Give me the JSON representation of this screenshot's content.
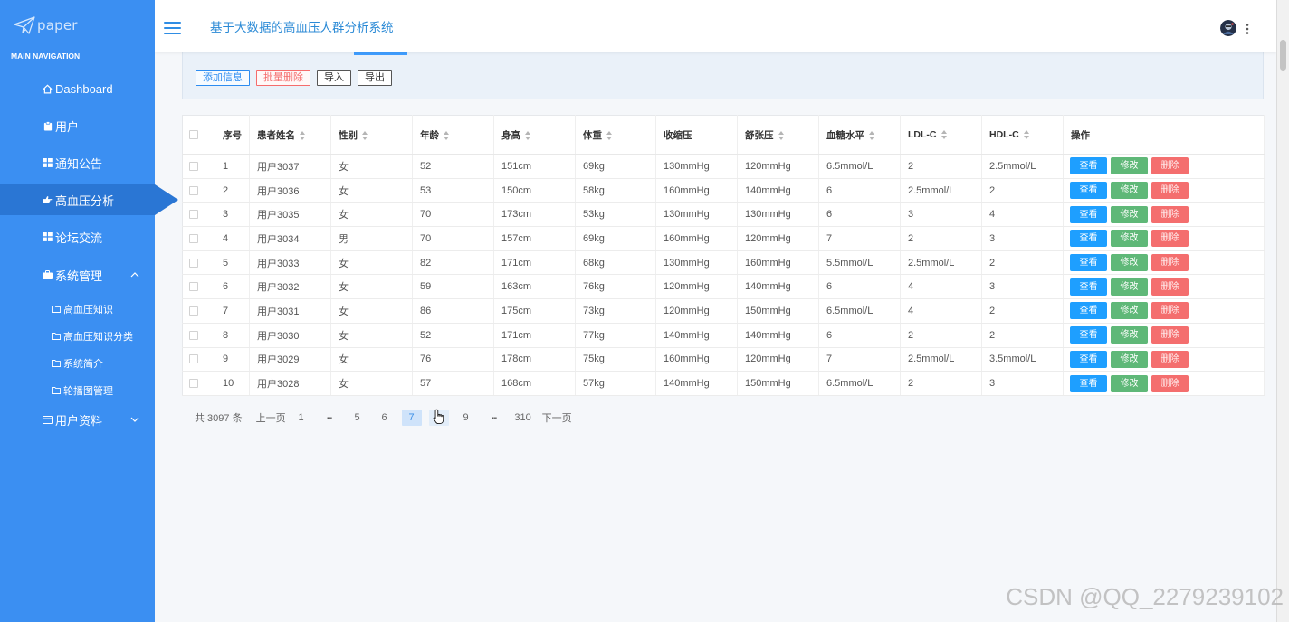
{
  "app": {
    "logo_text": "paper",
    "title": "基于大数据的高血压人群分析系统"
  },
  "sidebar": {
    "heading": "MAIN NAVIGATION",
    "items": [
      {
        "label": "Dashboard",
        "icon": "home-icon"
      },
      {
        "label": "用户",
        "icon": "clipboard-icon"
      },
      {
        "label": "通知公告",
        "icon": "grid-icon"
      },
      {
        "label": "高血压分析",
        "icon": "hand-icon",
        "active": true
      },
      {
        "label": "论坛交流",
        "icon": "grid-icon"
      },
      {
        "label": "系统管理",
        "icon": "briefcase-icon",
        "expanded": true,
        "children": [
          {
            "label": "高血压知识",
            "icon": "folder-icon"
          },
          {
            "label": "高血压知识分类",
            "icon": "folder-icon"
          },
          {
            "label": "系统简介",
            "icon": "folder-icon"
          },
          {
            "label": "轮播图管理",
            "icon": "folder-icon"
          }
        ]
      },
      {
        "label": "用户资料",
        "icon": "id-card-icon",
        "expanded": false
      }
    ]
  },
  "header": {
    "menu_icon": "hamburger-icon",
    "avatar_icon": "avatar",
    "more_icon": "more-vertical-icon"
  },
  "toolbar": {
    "add_label": "添加信息",
    "batch_delete_label": "批量删除",
    "import_label": "导入",
    "export_label": "导出"
  },
  "table": {
    "columns": [
      {
        "label": "序号",
        "sortable": false
      },
      {
        "label": "患者姓名",
        "sortable": true
      },
      {
        "label": "性别",
        "sortable": true
      },
      {
        "label": "年龄",
        "sortable": true
      },
      {
        "label": "身高",
        "sortable": true
      },
      {
        "label": "体重",
        "sortable": true
      },
      {
        "label": "收缩压",
        "sortable": false
      },
      {
        "label": "舒张压",
        "sortable": true
      },
      {
        "label": "血糖水平",
        "sortable": true
      },
      {
        "label": "LDL-C",
        "sortable": true
      },
      {
        "label": "HDL-C",
        "sortable": true
      },
      {
        "label": "操作",
        "sortable": false
      }
    ],
    "rows": [
      [
        "1",
        "用户3037",
        "女",
        "52",
        "151cm",
        "69kg",
        "130mmHg",
        "120mmHg",
        "6.5mmol/L",
        "2",
        "2.5mmol/L"
      ],
      [
        "2",
        "用户3036",
        "女",
        "53",
        "150cm",
        "58kg",
        "160mmHg",
        "140mmHg",
        "6",
        "2.5mmol/L",
        "2"
      ],
      [
        "3",
        "用户3035",
        "女",
        "70",
        "173cm",
        "53kg",
        "130mmHg",
        "130mmHg",
        "6",
        "3",
        "4"
      ],
      [
        "4",
        "用户3034",
        "男",
        "70",
        "157cm",
        "69kg",
        "160mmHg",
        "120mmHg",
        "7",
        "2",
        "3"
      ],
      [
        "5",
        "用户3033",
        "女",
        "82",
        "171cm",
        "68kg",
        "130mmHg",
        "160mmHg",
        "5.5mmol/L",
        "2.5mmol/L",
        "2"
      ],
      [
        "6",
        "用户3032",
        "女",
        "59",
        "163cm",
        "76kg",
        "120mmHg",
        "140mmHg",
        "6",
        "4",
        "3"
      ],
      [
        "7",
        "用户3031",
        "女",
        "86",
        "175cm",
        "73kg",
        "120mmHg",
        "150mmHg",
        "6.5mmol/L",
        "4",
        "2"
      ],
      [
        "8",
        "用户3030",
        "女",
        "52",
        "171cm",
        "77kg",
        "140mmHg",
        "140mmHg",
        "6",
        "2",
        "2"
      ],
      [
        "9",
        "用户3029",
        "女",
        "76",
        "178cm",
        "75kg",
        "160mmHg",
        "120mmHg",
        "7",
        "2.5mmol/L",
        "3.5mmol/L"
      ],
      [
        "10",
        "用户3028",
        "女",
        "57",
        "168cm",
        "57kg",
        "140mmHg",
        "150mmHg",
        "6.5mmol/L",
        "2",
        "3"
      ]
    ],
    "actions": {
      "view": "查看",
      "edit": "修改",
      "delete": "删除"
    }
  },
  "pagination": {
    "total": "共 3097 条",
    "prev": "上一页",
    "next": "下一页",
    "pages": [
      {
        "label": "1"
      },
      {
        "label": "..."
      },
      {
        "label": "5"
      },
      {
        "label": "6"
      },
      {
        "label": "7",
        "current": true
      },
      {
        "hovered": true,
        "cursor_icon": "hand-pointer-icon"
      },
      {
        "label": "9"
      },
      {
        "label": "..."
      },
      {
        "label": "310"
      }
    ]
  },
  "watermark": "CSDN @QQ_2279239102",
  "colors": {
    "sidebar": "#3b8ff2",
    "sidebar_active": "#2a76d4",
    "title": "#2b8ad6",
    "view_button": "#1e9fff",
    "edit_button": "#5fb878",
    "delete_button": "#f46e6e",
    "add_button": "#2d8cf0",
    "batch_delete_button": "#f56c6c"
  }
}
